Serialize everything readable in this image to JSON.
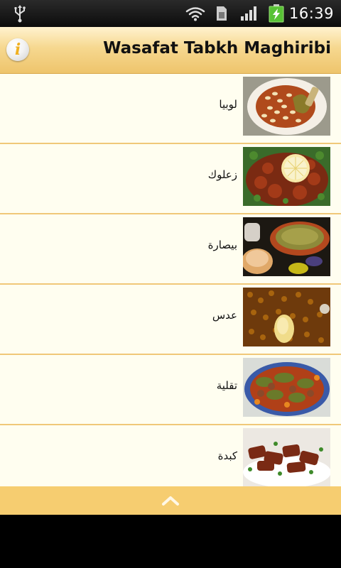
{
  "status_bar": {
    "time": "16:39",
    "icons": [
      "usb-icon",
      "wifi-icon",
      "sim-card-icon",
      "signal-icon",
      "battery-charging-icon"
    ]
  },
  "header": {
    "title": "Wasafat Tabkh Maghiribi",
    "info_icon": "info-icon",
    "info_glyph": "i"
  },
  "recipes": [
    {
      "name": "لوبيا",
      "thumbnail": "beans-plate-photo"
    },
    {
      "name": "زعلوك",
      "thumbnail": "zaalouk-lemon-photo"
    },
    {
      "name": "بيصارة",
      "thumbnail": "bissara-soup-photo"
    },
    {
      "name": "عدس",
      "thumbnail": "lentils-photo"
    },
    {
      "name": "تقلية",
      "thumbnail": "tqlia-dish-photo"
    },
    {
      "name": "كبدة",
      "thumbnail": "liver-plate-photo"
    }
  ],
  "footer": {
    "scroll_icon": "chevron-up-icon"
  },
  "colors": {
    "header_top": "#fff2cf",
    "header_bottom": "#eec46c",
    "list_background": "#fffef0",
    "divider": "#f0c878",
    "footer": "#f6cd70"
  }
}
